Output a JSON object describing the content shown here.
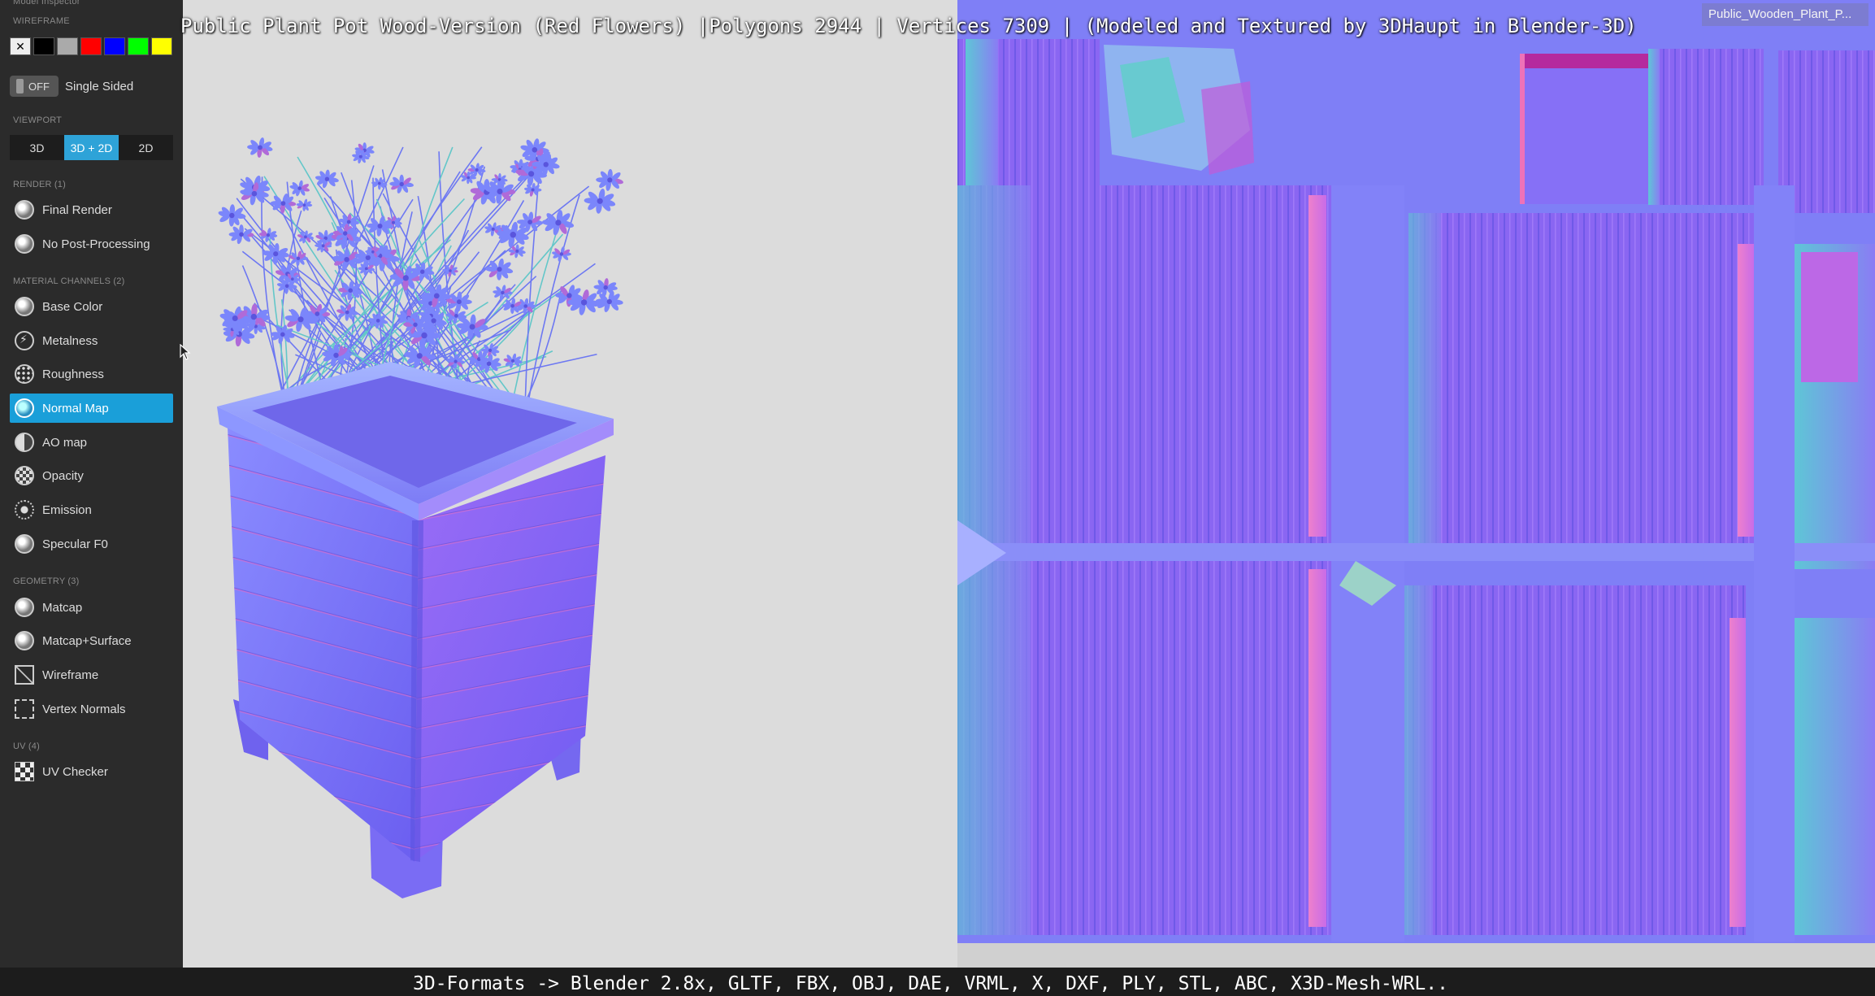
{
  "video_title": "Public Plant Pot Wood-Version (Red Flowers) |Polygons 2944 | Vertices 7309 | (Modeled and Textured by 3DHaupt in Blender-3D)",
  "filename_tag": "Public_Wooden_Plant_P...",
  "formats_line": "3D-Formats -> Blender 2.8x, GLTF, FBX, OBJ, DAE, VRML, X, DXF, PLY, STL, ABC, X3D-Mesh-WRL..",
  "sidebar": {
    "header_top": "Model Inspector",
    "wireframe_label": "WIREFRAME",
    "wireframe_colors": [
      "#000000",
      "#aaaaaa",
      "#ff0000",
      "#0000ff",
      "#00ff00",
      "#ffff00"
    ],
    "single_sided": {
      "toggle": "OFF",
      "label": "Single Sided"
    },
    "viewport": {
      "label": "VIEWPORT",
      "options": [
        "3D",
        "3D + 2D",
        "2D"
      ],
      "active": "3D + 2D"
    },
    "render": {
      "label": "RENDER (1)",
      "items": [
        "Final Render",
        "No Post-Processing"
      ]
    },
    "material_channels": {
      "label": "MATERIAL CHANNELS (2)",
      "items": [
        "Base Color",
        "Metalness",
        "Roughness",
        "Normal Map",
        "AO map",
        "Opacity",
        "Emission",
        "Specular F0"
      ],
      "active": "Normal Map"
    },
    "geometry": {
      "label": "GEOMETRY (3)",
      "items": [
        "Matcap",
        "Matcap+Surface",
        "Wireframe",
        "Vertex Normals"
      ]
    },
    "uv": {
      "label": "UV (4)",
      "items": [
        "UV Checker"
      ]
    }
  },
  "colors": {
    "accent": "#1a9fd9",
    "normal_map_base": "#8080ff",
    "sidebar_bg": "#2b2b2b"
  }
}
